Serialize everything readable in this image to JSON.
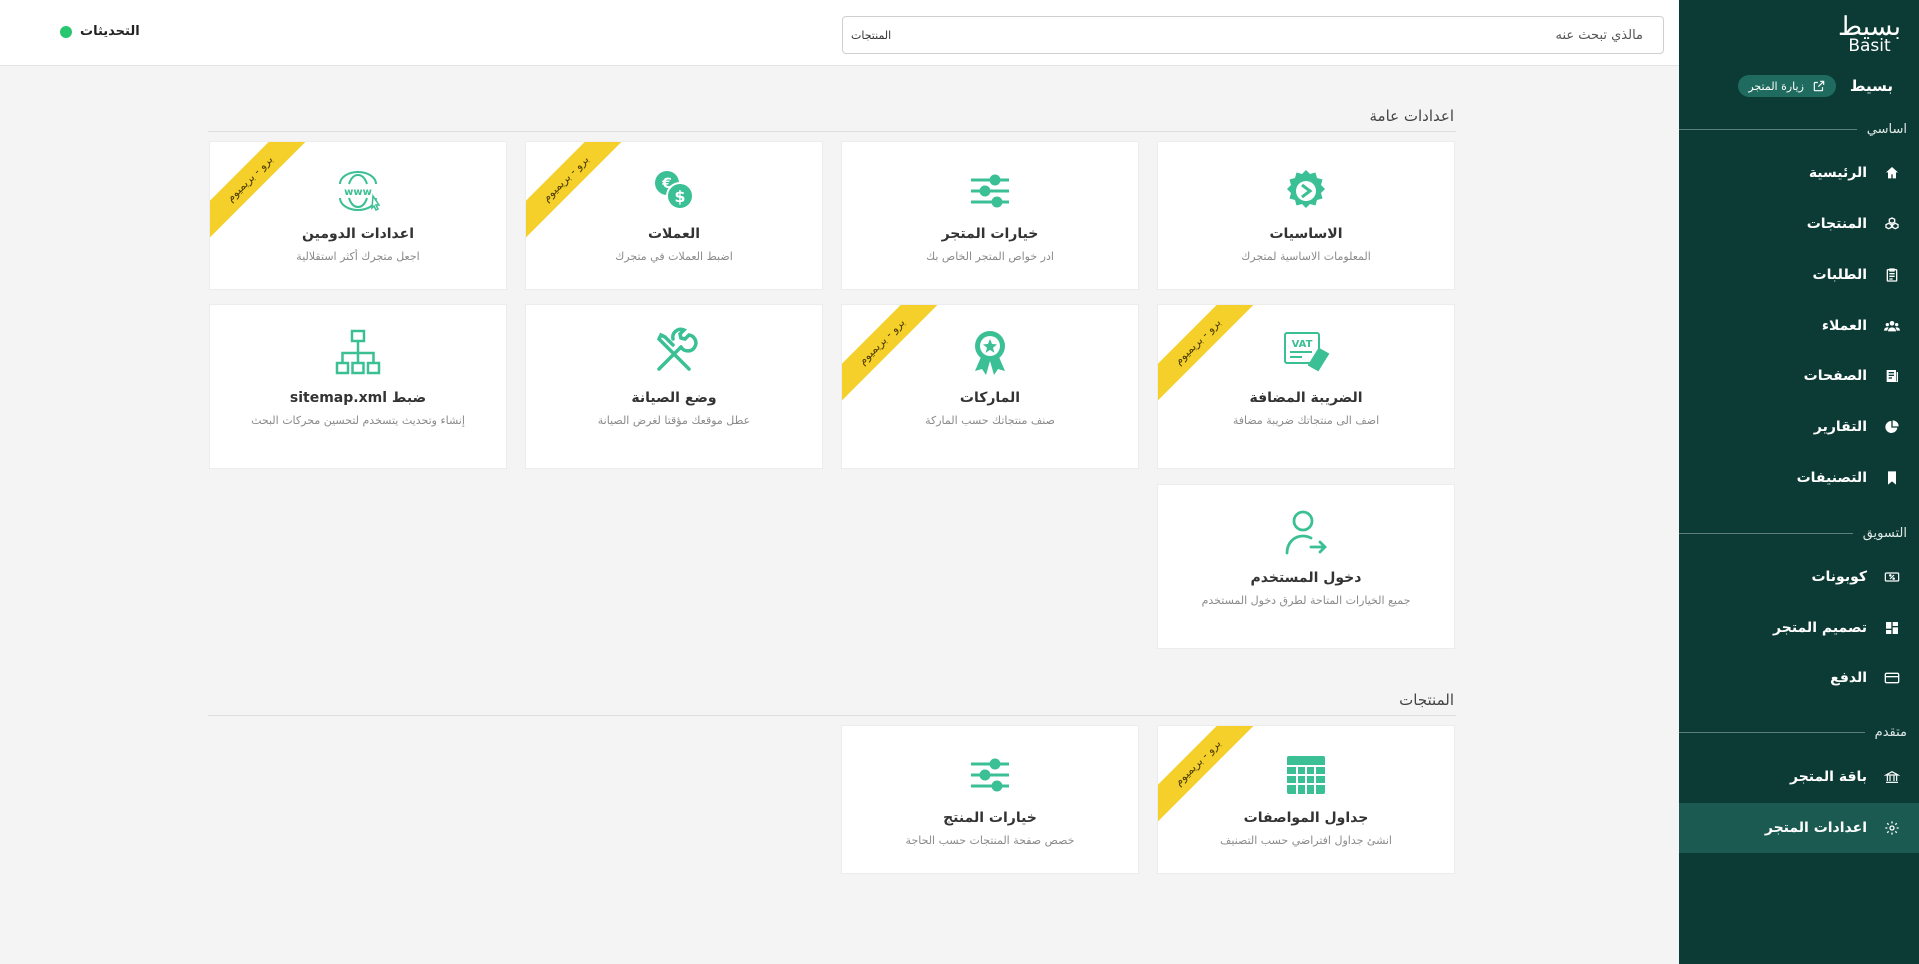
{
  "header": {
    "updates_label": "التحديثات",
    "search_placeholder": "مالذي تبحث عنه",
    "search_category": "المنتجات"
  },
  "sidebar": {
    "logo_ar": "بسيط",
    "logo_en": "Basit",
    "store_name": "بسيط",
    "visit_store": "زيارة المتجر",
    "sections": {
      "basic": "اساسي",
      "marketing": "التسويق",
      "advanced": "متقدم"
    },
    "items": [
      {
        "label": "الرئيسية",
        "icon": "home-icon"
      },
      {
        "label": "المنتجات",
        "icon": "boxes-icon"
      },
      {
        "label": "الطلبات",
        "icon": "clipboard-icon"
      },
      {
        "label": "العملاء",
        "icon": "users-icon"
      },
      {
        "label": "الصفحات",
        "icon": "pages-icon"
      },
      {
        "label": "التقارير",
        "icon": "pie-chart-icon"
      },
      {
        "label": "التصنيفات",
        "icon": "bookmark-icon"
      },
      {
        "label": "كوبونات",
        "icon": "coupon-icon"
      },
      {
        "label": "تصميم المتجر",
        "icon": "layout-icon"
      },
      {
        "label": "الدفع",
        "icon": "credit-card-icon"
      },
      {
        "label": "باقة المتجر",
        "icon": "bank-icon"
      },
      {
        "label": "اعدادات المتجر",
        "icon": "gear-icon"
      }
    ]
  },
  "groups": {
    "general": "اعدادات عامة",
    "products": "المنتجات"
  },
  "badge": "برو - بريميوم",
  "accent_color": "#3bbf94",
  "cards": {
    "basics": {
      "title": "الاساسيات",
      "desc": "المعلومات الاساسية لمتجرك",
      "icon": "gear-icon"
    },
    "store_options": {
      "title": "خيارات المتجر",
      "desc": "ادر خواص المتجر الخاص بك",
      "icon": "sliders-icon"
    },
    "currencies": {
      "title": "العملات",
      "desc": "اضبط العملات في متجرك",
      "icon": "currency-icon"
    },
    "domain": {
      "title": "اعدادات الدومين",
      "desc": "اجعل متجرك أكثر استقلالية",
      "icon": "www-icon"
    },
    "vat": {
      "title": "الضريبة المضافة",
      "desc": "اضف الى منتجاتك ضريبة مضافة",
      "icon": "vat-icon"
    },
    "brands": {
      "title": "الماركات",
      "desc": "صنف منتجاتك حسب الماركة",
      "icon": "award-icon"
    },
    "maintenance": {
      "title": "وضع الصيانة",
      "desc": "عطل موقعك مؤقتا لغرض الصيانة",
      "icon": "tools-icon"
    },
    "sitemap": {
      "title": "ضبط sitemap.xml",
      "desc": "إنشاء وتحديث يتسخدم لتحسين محركات البحث",
      "icon": "sitemap-icon"
    },
    "user_login": {
      "title": "دخول المستخدم",
      "desc": "جميع الخيارات المتاحة لطرق دخول المستخدم",
      "icon": "user-login-icon"
    },
    "spec_tables": {
      "title": "جداول المواصفات",
      "desc": "انشئ جداول افتراضي حسب التصنيف",
      "icon": "table-icon"
    },
    "product_options": {
      "title": "خيارات المنتج",
      "desc": "خصص صفحة المنتجات حسب الحاجة",
      "icon": "sliders-icon"
    }
  }
}
